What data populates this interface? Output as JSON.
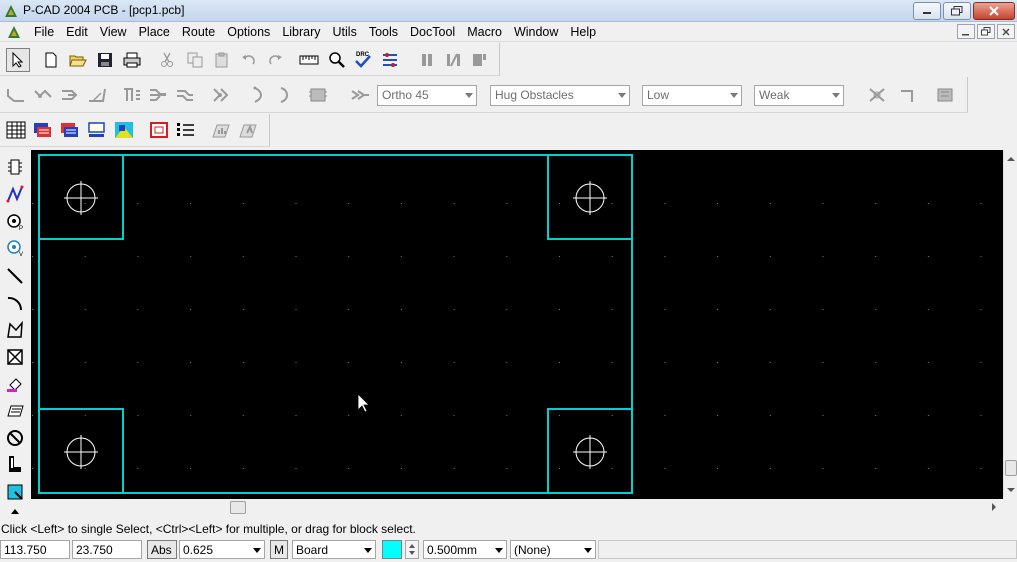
{
  "window": {
    "title": "P-CAD 2004 PCB - [pcp1.pcb]"
  },
  "menu": [
    "File",
    "Edit",
    "View",
    "Place",
    "Route",
    "Options",
    "Library",
    "Utils",
    "Tools",
    "DocTool",
    "Macro",
    "Window",
    "Help"
  ],
  "route_toolbar": {
    "mode": "Ortho 45",
    "obstacle": "Hug Obstacles",
    "gloss1": "Low",
    "gloss2": "Weak"
  },
  "canvas": {
    "background": "#000000",
    "board_color": "#00d0d0"
  },
  "status": {
    "prompt": "Click <Left> to single Select, <Ctrl><Left> for multiple, or drag for block select.",
    "x": "113.750",
    "y": "23.750",
    "abs_label": "Abs",
    "grid": "0.625",
    "m_label": "M",
    "layer": "Board",
    "layer_color": "#00ffff",
    "line_width": "0.500mm",
    "net": "(None)"
  }
}
